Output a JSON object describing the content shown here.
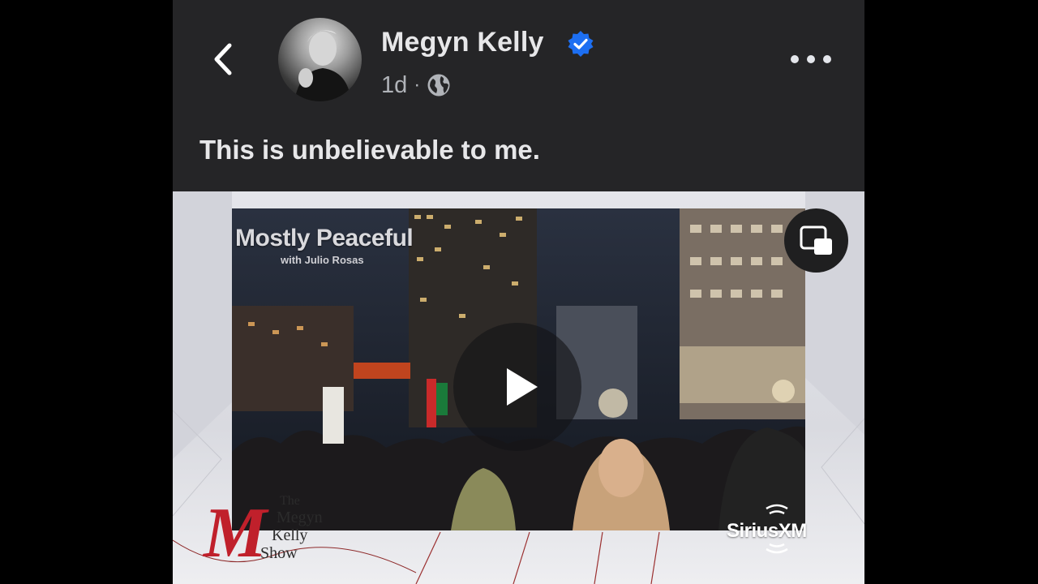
{
  "post": {
    "author": "Megyn Kelly",
    "time_ago": "1d",
    "separator": "·",
    "visibility_icon": "globe-icon",
    "caption": "This is unbelievable to me."
  },
  "video": {
    "overlay_title": "Mostly Peaceful",
    "overlay_subtitle": "with Julio Rosas",
    "show_logo_lines": [
      "The",
      "Megyn",
      "Kelly",
      "Show"
    ],
    "brand": "SiriusXM"
  },
  "icons": {
    "back": "chevron-left-icon",
    "verified": "verified-badge-icon",
    "more": "more-options-icon",
    "play": "play-icon",
    "pip": "picture-in-picture-icon"
  },
  "colors": {
    "background": "#252527",
    "text": "#e7e7e9",
    "secondary_text": "#b0b3b8",
    "verified_blue": "#1d6ff2",
    "logo_red": "#c0202b"
  }
}
